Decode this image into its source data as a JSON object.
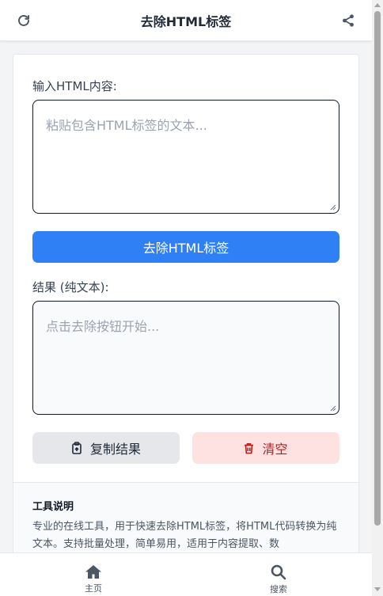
{
  "header": {
    "title": "去除HTML标签",
    "refresh_icon": "refresh-icon",
    "share_icon": "share-icon"
  },
  "input": {
    "label": "输入HTML内容:",
    "placeholder": "粘贴包含HTML标签的文本..."
  },
  "primary_button": {
    "label": "去除HTML标签"
  },
  "result": {
    "label": "结果 (纯文本):",
    "placeholder": "点击去除按钮开始..."
  },
  "actions": {
    "copy_label": "复制结果",
    "clear_label": "清空"
  },
  "help": {
    "title": "工具说明",
    "text": "专业的在线工具，用于快速去除HTML标签，将HTML代码转换为纯文本。支持批量处理，简单易用，适用于内容提取、数"
  },
  "nav": {
    "home_label": "主页",
    "search_label": "搜索"
  },
  "colors": {
    "primary": "#2f80f5",
    "danger_bg": "#fee2e2",
    "danger_text": "#b91c1c",
    "neutral_btn": "#e5e7eb"
  }
}
